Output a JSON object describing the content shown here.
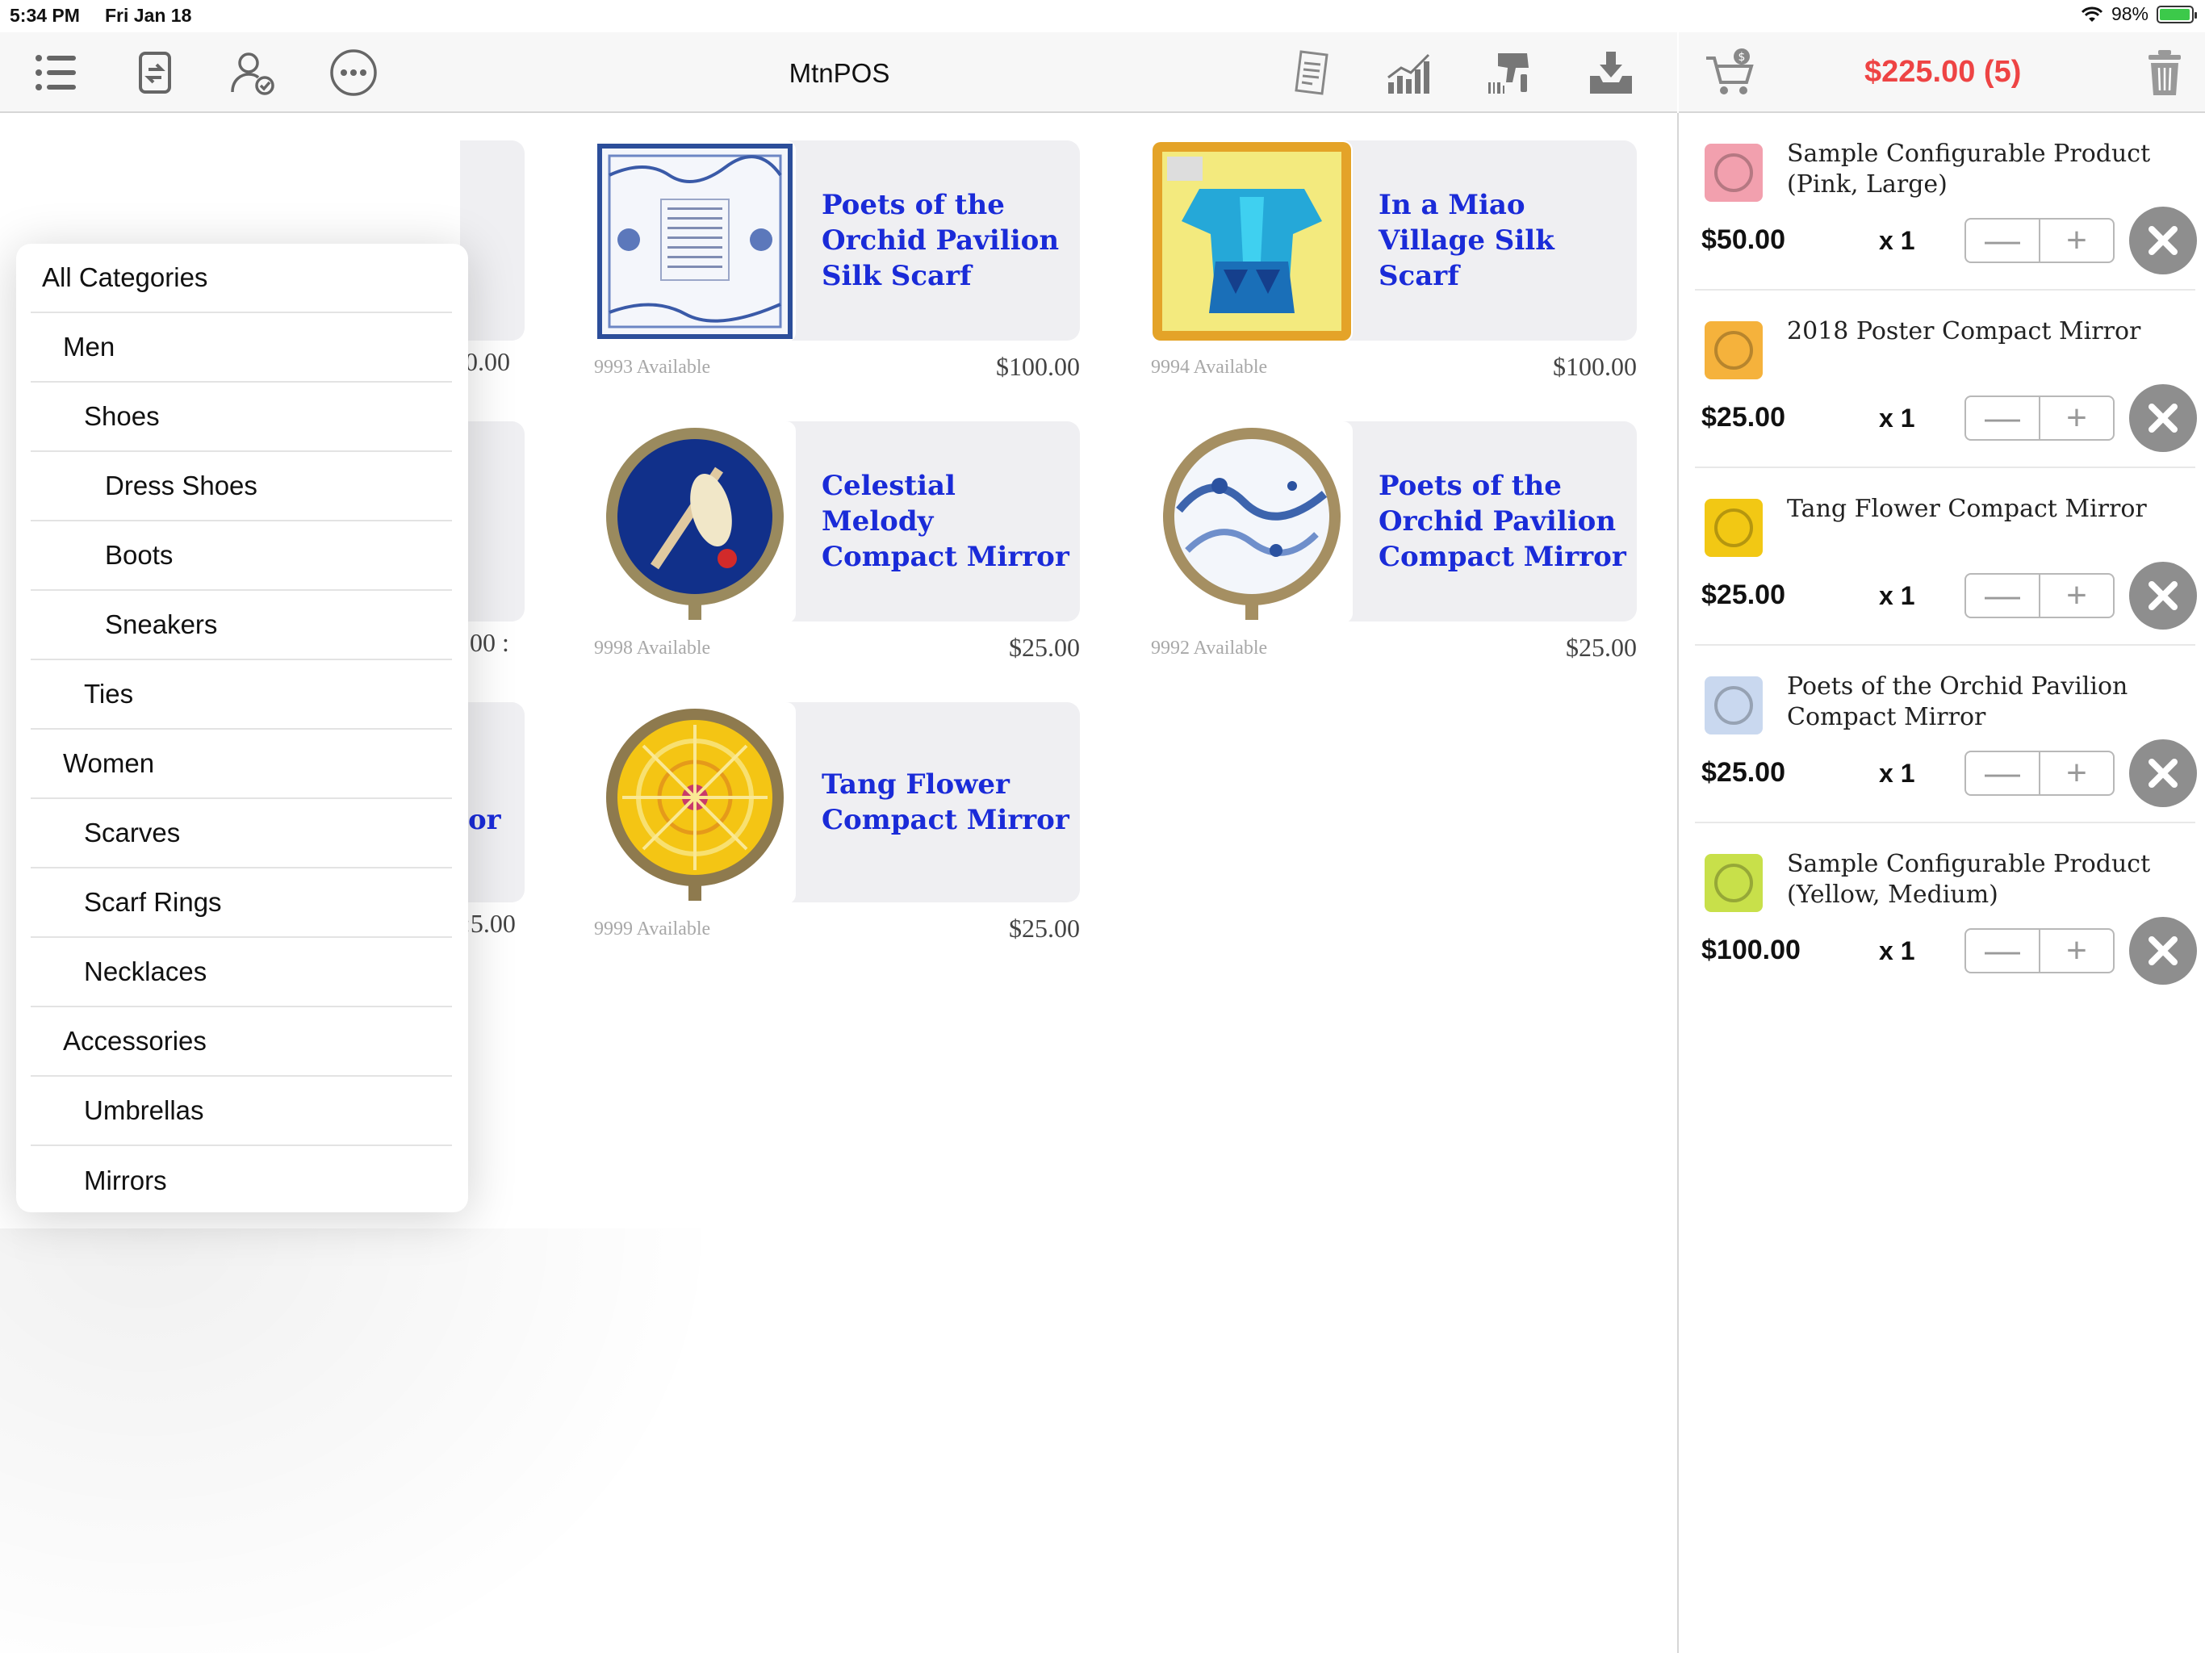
{
  "status": {
    "time": "5:34 PM",
    "date": "Fri Jan 18",
    "battery": "98%",
    "battery_level": 0.98
  },
  "toolbar": {
    "title": "MtnPOS",
    "left_icons": [
      "list-icon",
      "sync-icon",
      "customer-check-icon",
      "more-icon"
    ],
    "right_icons": [
      "receipt-icon",
      "reports-chart-icon",
      "barcode-scanner-icon",
      "download-tray-icon"
    ]
  },
  "cart": {
    "total": "$225.00 (5)",
    "items": [
      {
        "name": "Sample Configurable Product (Pink, Large)",
        "price": "$50.00",
        "qty": "x 1",
        "thumb_color": "#f2a0ae"
      },
      {
        "name": "2018 Poster Compact Mirror",
        "price": "$25.00",
        "qty": "x 1",
        "thumb_color": "#f5b23c"
      },
      {
        "name": "Tang Flower Compact Mirror",
        "price": "$25.00",
        "qty": "x 1",
        "thumb_color": "#f2c814"
      },
      {
        "name": "Poets of the Orchid Pavilion Compact Mirror",
        "price": "$25.00",
        "qty": "x 1",
        "thumb_color": "#c9d8ef"
      },
      {
        "name": "Sample Configurable Product (Yellow, Medium)",
        "price": "$100.00",
        "qty": "x 1",
        "thumb_color": "#c8e04a"
      }
    ],
    "stepper_minus": "—",
    "stepper_plus": "+"
  },
  "categories": [
    {
      "label": "All Categories",
      "level": 0
    },
    {
      "label": "Men",
      "level": 1
    },
    {
      "label": "Shoes",
      "level": 2
    },
    {
      "label": "Dress Shoes",
      "level": 3
    },
    {
      "label": "Boots",
      "level": 3
    },
    {
      "label": "Sneakers",
      "level": 3
    },
    {
      "label": "Ties",
      "level": 2
    },
    {
      "label": "Women",
      "level": 1
    },
    {
      "label": "Scarves",
      "level": 2
    },
    {
      "label": "Scarf Rings",
      "level": 2
    },
    {
      "label": "Necklaces",
      "level": 2
    },
    {
      "label": "Accessories",
      "level": 1
    },
    {
      "label": "Umbrellas",
      "level": 2
    },
    {
      "label": "Mirrors",
      "level": 2
    }
  ],
  "products": [
    {
      "name": "Poets of the Orchid Pavilion Silk Scarf",
      "available": "9993 Available",
      "price": "$100.00",
      "kind": "scarf-blue"
    },
    {
      "name": "In a Miao Village Silk Scarf",
      "available": "9994 Available",
      "price": "$100.00",
      "kind": "scarf-miao"
    },
    {
      "name": "Celestial Melody Compact Mirror",
      "available": "9998 Available",
      "price": "$25.00",
      "kind": "mirror-navy"
    },
    {
      "name": "Poets of the Orchid Pavilion Compact Mirror",
      "available": "9992 Available",
      "price": "$25.00",
      "kind": "mirror-bluewhite"
    },
    {
      "name": "Tang Flower Compact Mirror",
      "available": "9999 Available",
      "price": "$25.00",
      "kind": "mirror-yellow"
    }
  ],
  "hidden_column": {
    "price_1": "0.00",
    "price_2": "00 :",
    "name_3": "or",
    "price_3": ":5.00"
  }
}
